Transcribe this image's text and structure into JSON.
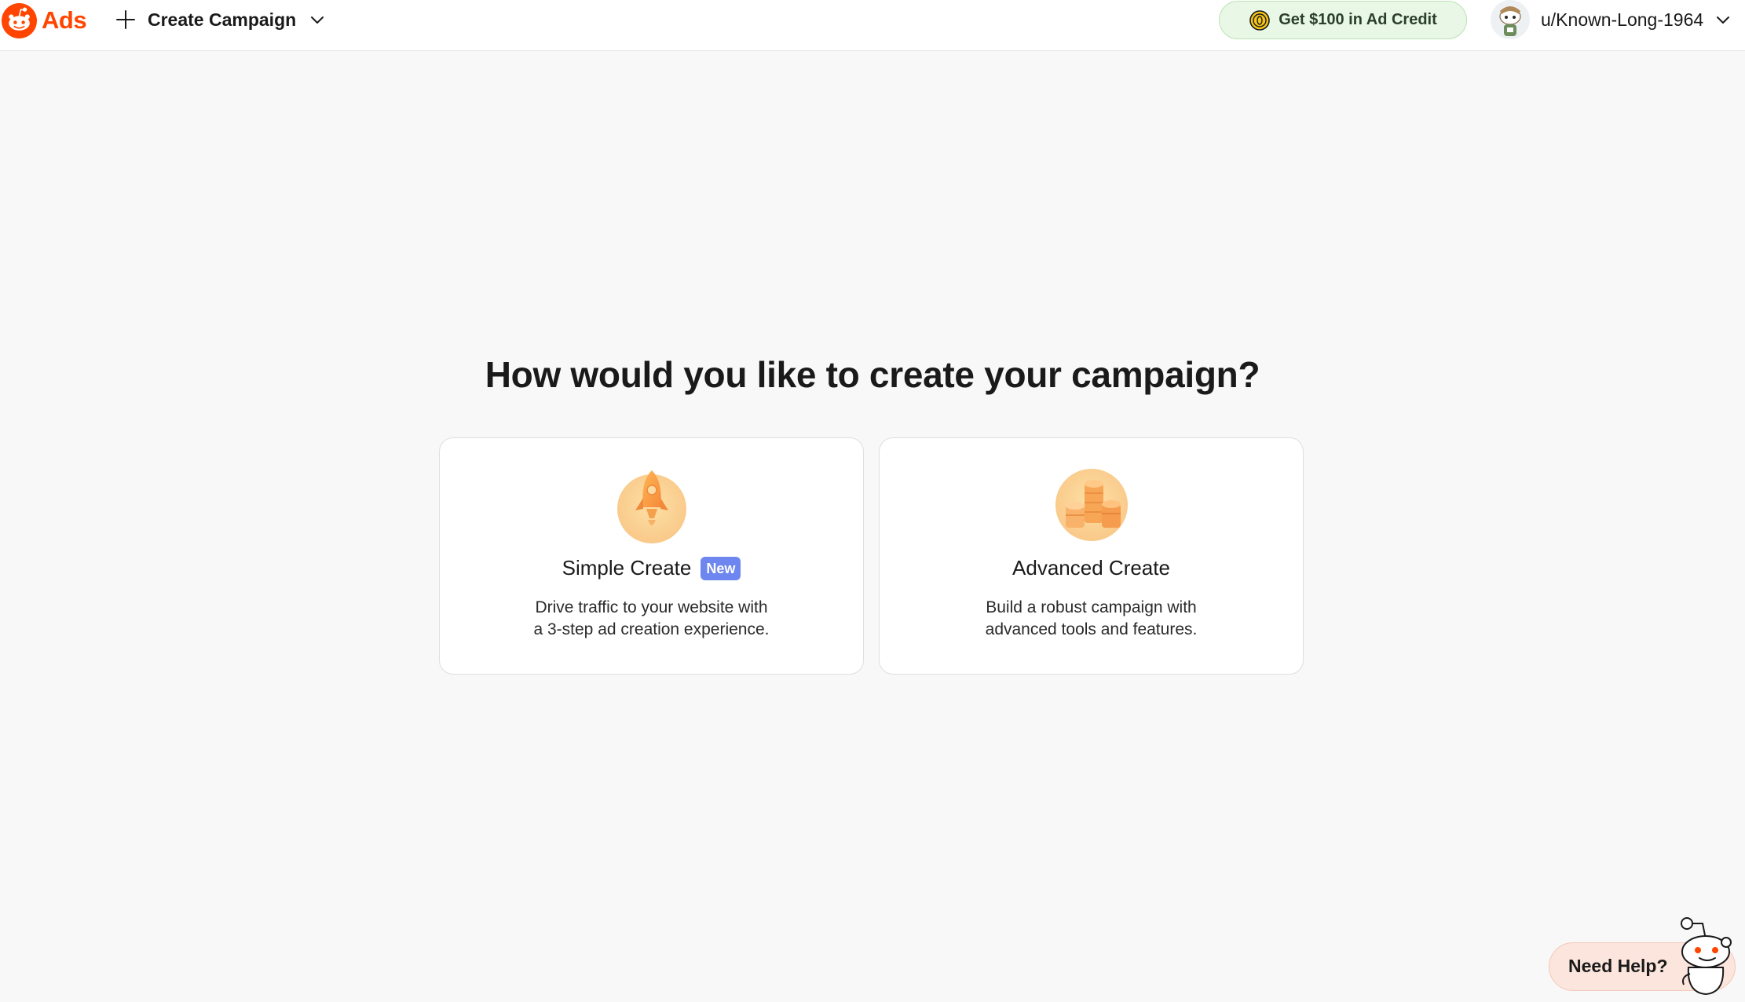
{
  "header": {
    "logo_text": "Ads",
    "create_campaign_label": "Create Campaign",
    "ad_credit_label": "Get $100 in Ad Credit",
    "username": "u/Known-Long-1964"
  },
  "main": {
    "headline": "How would you like to create your campaign?",
    "cards": [
      {
        "title": "Simple Create",
        "badge": "New",
        "desc_line1": "Drive traffic to your website with",
        "desc_line2": "a 3-step ad creation experience.",
        "icon": "rocket-icon"
      },
      {
        "title": "Advanced Create",
        "desc_line1": "Build a robust campaign with",
        "desc_line2": "advanced tools and features.",
        "icon": "coin-stacks-icon"
      }
    ]
  },
  "help": {
    "label": "Need Help?"
  },
  "colors": {
    "brand": "#ff4500",
    "credit_bg": "#e9f8e6",
    "badge": "#6d86f0",
    "help_bg": "#fbe5dc"
  }
}
